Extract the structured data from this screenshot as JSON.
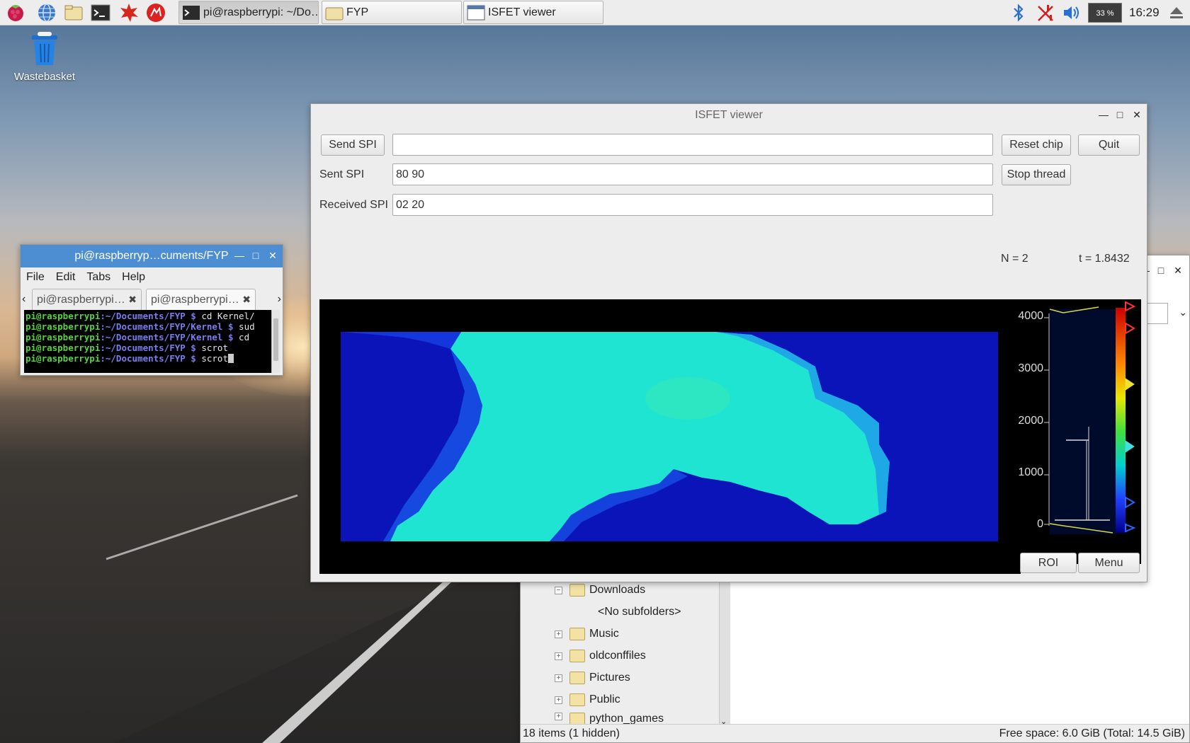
{
  "taskbar": {
    "tasks": [
      {
        "label": "pi@raspberrypi: ~/Do…",
        "icon": "terminal-icon"
      },
      {
        "label": "FYP",
        "icon": "folder-icon"
      },
      {
        "label": "ISFET viewer",
        "icon": "window-icon"
      }
    ],
    "cpu_percent": "33 %",
    "clock": "16:29"
  },
  "desktop": {
    "icons": [
      {
        "label": "Wastebasket",
        "icon": "wastebasket-icon"
      }
    ]
  },
  "terminal": {
    "title": "pi@raspberryp…cuments/FYP",
    "menu": [
      "File",
      "Edit",
      "Tabs",
      "Help"
    ],
    "tabs": [
      "pi@raspberrypi: …",
      "pi@raspberrypi: …"
    ],
    "lines": [
      {
        "user": "pi@raspberrypi",
        "path": ":~/Documents/FYP $",
        "cmd": " cd Kernel/"
      },
      {
        "user": "pi@raspberrypi",
        "path": ":~/Documents/FYP/Kernel $",
        "cmd": " sud"
      },
      {
        "user": "pi@raspberrypi",
        "path": ":~/Documents/FYP/Kernel $",
        "cmd": " cd"
      },
      {
        "user": "pi@raspberrypi",
        "path": ":~/Documents/FYP $",
        "cmd": " scrot"
      },
      {
        "user": "pi@raspberrypi",
        "path": ":~/Documents/FYP $",
        "cmd": " scrot"
      }
    ]
  },
  "file_manager": {
    "tree": [
      {
        "label": "Downloads",
        "expander": "⊟"
      },
      {
        "label": "<No subfolders>",
        "expander": ""
      },
      {
        "label": "Music",
        "expander": "⊞"
      },
      {
        "label": "oldconffiles",
        "expander": "⊞"
      },
      {
        "label": "Pictures",
        "expander": "⊞"
      },
      {
        "label": "Public",
        "expander": "⊞"
      },
      {
        "label": "python_games",
        "expander": "⊞"
      }
    ],
    "status_left": "18 items (1 hidden)",
    "status_right": "Free space: 6.0 GiB (Total: 14.5 GiB)"
  },
  "isfet": {
    "title": "ISFET viewer",
    "send_spi_label": "Send SPI",
    "send_spi_value": "",
    "sent_spi_label": "Sent SPI",
    "sent_spi_value": "80 90",
    "received_spi_label": "Received SPI",
    "received_spi_value": "02 20",
    "reset_chip_label": "Reset chip",
    "quit_label": "Quit",
    "stop_thread_label": "Stop thread",
    "n_label": "N = 2",
    "t_label": "t = 1.8432",
    "roi_label": "ROI",
    "menu_label": "Menu",
    "histogram_ticks": [
      "4000",
      "3000",
      "2000",
      "1000",
      "0"
    ]
  }
}
